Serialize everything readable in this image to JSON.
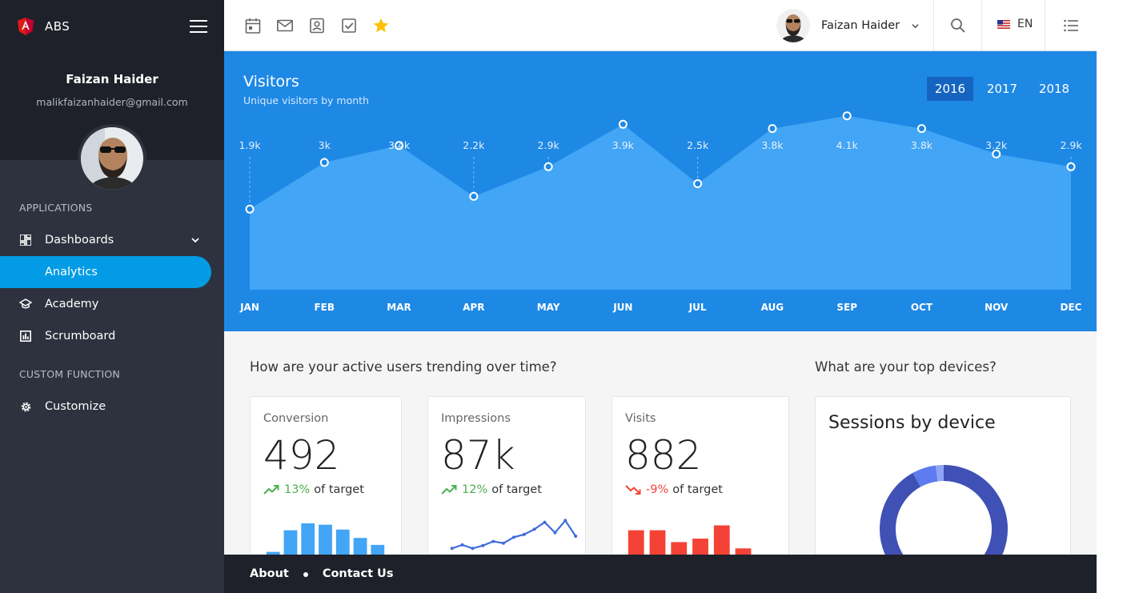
{
  "brand": {
    "name": "ABS",
    "logo_icon": "angular-logo-icon"
  },
  "user": {
    "name": "Faizan Haider",
    "email": "malikfaizanhaider@gmail.com"
  },
  "nav": {
    "section_applications": "APPLICATIONS",
    "section_custom": "CUSTOM FUNCTION",
    "items": [
      {
        "label": "Dashboards",
        "icon": "dashboard-icon",
        "expanded": true
      },
      {
        "label": "Analytics",
        "active": true
      },
      {
        "label": "Academy",
        "icon": "school-icon"
      },
      {
        "label": "Scrumboard",
        "icon": "assessment-icon"
      },
      {
        "label": "Customize",
        "icon": "settings-icon"
      }
    ]
  },
  "topbar": {
    "shortcuts": [
      "calendar-icon",
      "mail-icon",
      "contacts-icon",
      "todo-icon",
      "star-icon"
    ],
    "user_name": "Faizan Haider",
    "language": "EN",
    "star_color": "#ffc107"
  },
  "visitors": {
    "title": "Visitors",
    "subtitle": "Unique visitors by month",
    "years": [
      "2016",
      "2017",
      "2018"
    ],
    "active_year": "2016"
  },
  "chart_data": {
    "type": "area",
    "categories": [
      "JAN",
      "FEB",
      "MAR",
      "APR",
      "MAY",
      "JUN",
      "JUL",
      "AUG",
      "SEP",
      "OCT",
      "NOV",
      "DEC"
    ],
    "values": [
      1.9,
      3.0,
      3.4,
      2.2,
      2.9,
      3.9,
      2.5,
      3.8,
      4.1,
      3.8,
      3.2,
      2.9
    ],
    "data_labels": [
      "1.9k",
      "3k",
      "3.4k",
      "2.2k",
      "2.9k",
      "3.9k",
      "2.5k",
      "3.8k",
      "4.1k",
      "3.8k",
      "3.2k",
      "2.9k"
    ],
    "ylim": [
      0,
      5
    ],
    "colors": {
      "background": "#1e88e5",
      "fill": "#42a5f5",
      "point": "#ffffff"
    }
  },
  "content": {
    "question_users": "How are your active users trending over time?",
    "question_devices": "What are your top devices?",
    "cards": [
      {
        "label": "Conversion",
        "value": "492",
        "pct": "13%",
        "target_text": "of target",
        "direction": "up",
        "color": "#42a5f5",
        "chart": "bar",
        "bars": [
          0.1,
          0.72,
          0.92,
          0.88,
          0.74,
          0.5,
          0.3
        ]
      },
      {
        "label": "Impressions",
        "value": "87k",
        "pct": "12%",
        "target_text": "of target",
        "direction": "up",
        "color": "#3f6bdc",
        "chart": "line",
        "points": [
          0.2,
          0.3,
          0.2,
          0.28,
          0.4,
          0.35,
          0.52,
          0.6,
          0.75,
          0.95,
          0.65,
          1.0,
          0.55
        ]
      },
      {
        "label": "Visits",
        "value": "882",
        "pct": "-9%",
        "target_text": "of target",
        "direction": "down",
        "color": "#f44336",
        "chart": "bar",
        "bars": [
          0.72,
          0.72,
          0.38,
          0.48,
          0.86,
          0.2
        ]
      }
    ],
    "sessions_card": {
      "title": "Sessions by device",
      "ring_color": "#3f51b5",
      "segments": [
        0.92,
        0.06,
        0.02
      ]
    }
  },
  "footer": {
    "about": "About",
    "contact": "Contact Us"
  }
}
